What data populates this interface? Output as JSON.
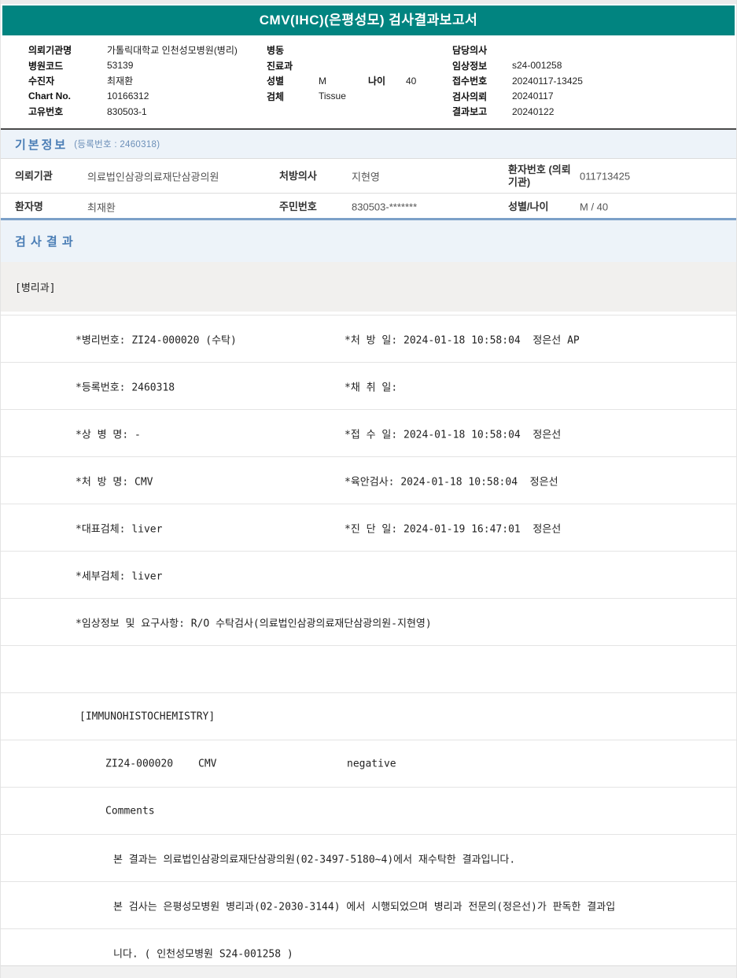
{
  "colors": {
    "header_teal": "#018480",
    "section_title_blue": "#4A7DB5",
    "section_bg_blue": "#EDF3F9",
    "divider_blue": "#7BA0C8",
    "dept_band_gray": "#F1F0EE"
  },
  "title_bar": {
    "title": "CMV(IHC)(은평성모) 검사결과보고서"
  },
  "patient_header": {
    "left": [
      {
        "label": "의뢰기관명",
        "value": "가톨릭대학교 인천성모병원(병리)"
      },
      {
        "label": "병원코드",
        "value": "53139"
      },
      {
        "label": "수진자",
        "value": "최재환"
      },
      {
        "label": "Chart No.",
        "value": "10166312"
      },
      {
        "label": "고유번호",
        "value": "830503-1"
      }
    ],
    "middle": [
      {
        "label": "병동",
        "value": ""
      },
      {
        "label": "진료과",
        "value": ""
      },
      {
        "label": "성별",
        "value": "M",
        "label2": "나이",
        "value2": "40"
      },
      {
        "label": "검체",
        "value": "Tissue"
      }
    ],
    "right": [
      {
        "label": "담당의사",
        "value": ""
      },
      {
        "label": "임상정보",
        "value": "s24-001258"
      },
      {
        "label": "접수번호",
        "value": "20240117-13425"
      },
      {
        "label": "검사의뢰",
        "value": "20240117"
      },
      {
        "label": "결과보고",
        "value": "20240122"
      }
    ]
  },
  "basic_info": {
    "title": "기본정보",
    "subtitle": "(등록번호 : 2460318)",
    "rows": [
      [
        {
          "label": "의뢰기관",
          "value": "의료법인삼광의료재단삼광의원"
        },
        {
          "label": "처방의사",
          "value": "지현영"
        },
        {
          "label": "환자번호 (의뢰기관)",
          "value": "011713425"
        }
      ],
      [
        {
          "label": "환자명",
          "value": "최재환"
        },
        {
          "label": "주민번호",
          "value": "830503-*******"
        },
        {
          "label": "성별/나이",
          "value": "M / 40"
        }
      ]
    ]
  },
  "results": {
    "title": "검 사 결 과",
    "department": "[병리과]",
    "rows": [
      [
        {
          "t": "*병리번호: ZI24-000020 (수탁)",
          "pos": "l1"
        },
        {
          "t": "*처 방 일: 2024-01-18 10:58:04  정은선 AP",
          "pos": "r1"
        }
      ],
      [
        {
          "t": "*등록번호: 2460318",
          "pos": "l1"
        },
        {
          "t": "*채 취 일:",
          "pos": "r1"
        }
      ],
      [
        {
          "t": "*상 병 명: -",
          "pos": "l1"
        },
        {
          "t": "*접 수 일: 2024-01-18 10:58:04  정은선",
          "pos": "r1"
        }
      ],
      [
        {
          "t": "*처 방 명: CMV",
          "pos": "l1"
        },
        {
          "t": "*육안검사: 2024-01-18 10:58:04  정은선",
          "pos": "r1"
        }
      ],
      [
        {
          "t": "*대표검체: liver",
          "pos": "l1"
        },
        {
          "t": "*진 단 일: 2024-01-19 16:47:01  정은선",
          "pos": "r1"
        }
      ],
      [
        {
          "t": "*세부검체: liver",
          "pos": "l1"
        }
      ],
      [
        {
          "t": "*임상정보 및 요구사항: R/O 수탁검사(의료법인삼광의료재단삼광의원-지현영)",
          "pos": "l1"
        }
      ],
      [],
      [
        {
          "t": "[IMMUNOHISTOCHEMISTRY]",
          "pos": "s"
        }
      ],
      [
        {
          "t": "ZI24-000020",
          "pos": "i"
        },
        {
          "t": "CMV",
          "pos": "c2"
        },
        {
          "t": "negative",
          "pos": "c3"
        }
      ],
      [
        {
          "t": "Comments",
          "pos": "i"
        }
      ],
      [
        {
          "t": "본 결과는 의료법인삼광의료재단삼광의원(02-3497-5180~4)에서 재수탁한 결과입니다.",
          "pos": "m"
        }
      ],
      [
        {
          "t": "본 검사는 은평성모병원 병리과(02-2030-3144) 에서 시행되었으며 병리과 전문의(정은선)가 판독한 결과입",
          "pos": "m"
        }
      ],
      [
        {
          "t": "니다. ( 인천성모병원 S24-001258 )",
          "pos": "m"
        }
      ]
    ]
  }
}
